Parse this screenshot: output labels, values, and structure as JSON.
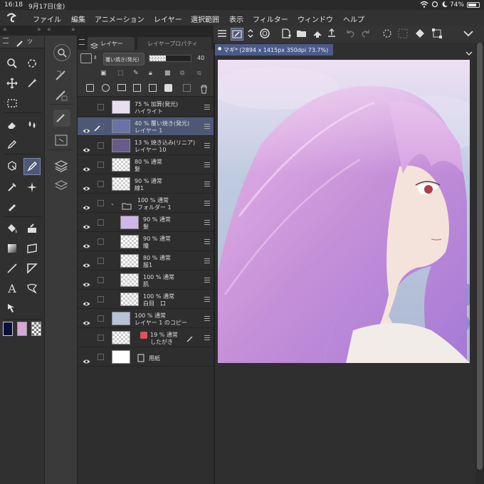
{
  "status": {
    "time": "16:18",
    "date": "9月17日(金)",
    "battery": "74%"
  },
  "menu": [
    "ファイル",
    "編集",
    "アニメーション",
    "レイヤー",
    "選択範囲",
    "表示",
    "フィルター",
    "ウィンドウ",
    "ヘルプ"
  ],
  "subtool_tab": "ツ",
  "layer_tabs": {
    "layer": "レイヤー",
    "property": "レイヤープロパティ"
  },
  "blend_mode": "覆い焼き(発光)",
  "opacity_value": "40",
  "canvas_tab": "マギ* (2894 x 1415px 350dpi 73.7%)",
  "layers": [
    {
      "line1": "75 % 加算(発光)",
      "line2": "ハイライト",
      "visible": false
    },
    {
      "line1": "40 % 覆い焼き(発光)",
      "line2": "レイヤー 1",
      "visible": true,
      "selected": true
    },
    {
      "line1": "13 % 焼き込み(リニア)",
      "line2": "レイヤー 10",
      "visible": true
    },
    {
      "line1": "80 % 通常",
      "line2": "髪",
      "visible": true
    },
    {
      "line1": "90 % 通常",
      "line2": "線1",
      "visible": true
    },
    {
      "line1": "100 % 通常",
      "line2": "フォルダー 1",
      "visible": true,
      "folder": true
    },
    {
      "line1": "90 % 通常",
      "line2": "髪",
      "visible": true,
      "indent": true
    },
    {
      "line1": "90 % 通常",
      "line2": "瞳",
      "visible": true,
      "indent": true
    },
    {
      "line1": "80 % 通常",
      "line2": "服1",
      "visible": true,
      "indent": true
    },
    {
      "line1": "100 % 通常",
      "line2": "肌",
      "visible": true,
      "indent": true
    },
    {
      "line1": "100 % 通常",
      "line2": "白目　口",
      "visible": true,
      "indent": true
    },
    {
      "line1": "100 % 通常",
      "line2": "レイヤー 1 のコピー",
      "visible": true
    },
    {
      "line1": "19 % 通常",
      "line2": "したがき",
      "visible": false,
      "draft": true
    },
    {
      "line1": "",
      "line2": "用紙",
      "visible": true,
      "paper": true
    }
  ],
  "colors": {
    "main": "#0a0f3a",
    "sub": "#d6a8d8",
    "accent": "#4e5876"
  }
}
